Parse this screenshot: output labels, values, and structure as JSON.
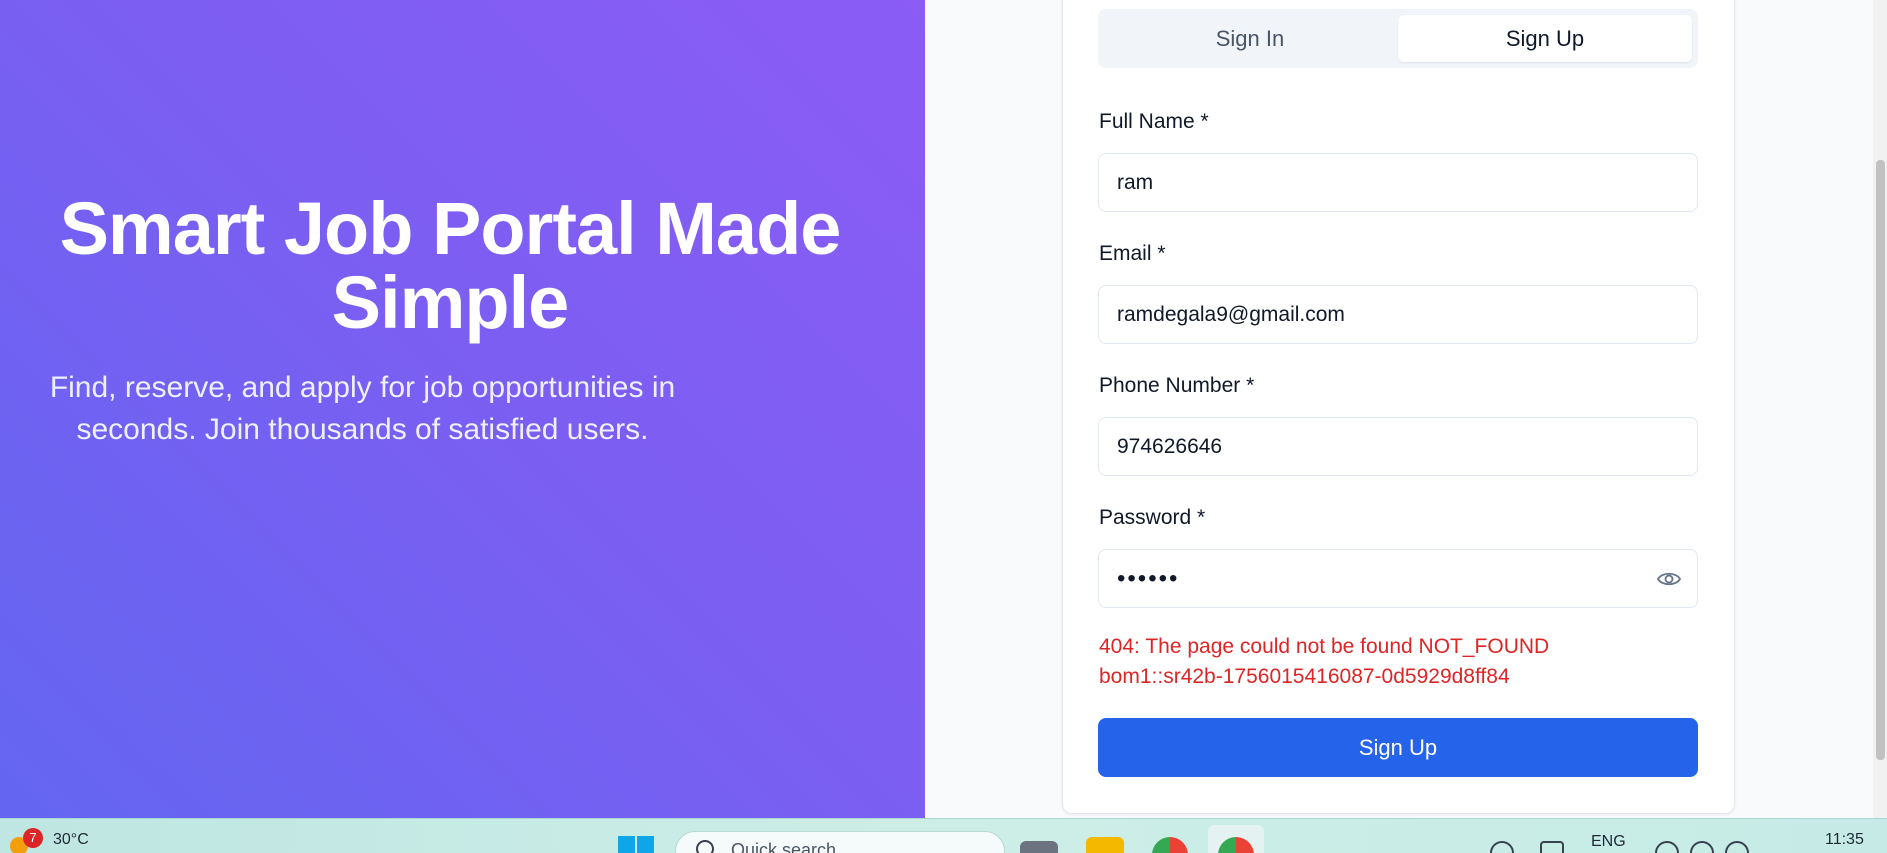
{
  "hero": {
    "title": "Smart Job Portal Made Simple",
    "subtitle": "Find, reserve, and apply for job opportunities in seconds. Join thousands of satisfied users."
  },
  "auth": {
    "tabs": {
      "signin": "Sign In",
      "signup": "Sign Up",
      "active": "Sign Up"
    },
    "fields": {
      "full_name": {
        "label": "Full Name *",
        "value": "ram"
      },
      "email": {
        "label": "Email *",
        "value": "ramdegala9@gmail.com"
      },
      "phone": {
        "label": "Phone Number *",
        "value": "974626646"
      },
      "password": {
        "label": "Password *",
        "value": "••••••"
      }
    },
    "error_line1": "404: The page could not be found NOT_FOUND",
    "error_line2": "bom1::sr42b-1756015416087-0d5929d8ff84",
    "submit_label": "Sign Up"
  },
  "taskbar": {
    "weather_badge": "7",
    "temperature": "30°C",
    "search_placeholder": "Quick search",
    "language": "ENG",
    "time": "11:35"
  },
  "colors": {
    "hero_gradient_start": "#6366f1",
    "hero_gradient_end": "#8b5cf6",
    "primary_button": "#2563eb",
    "error_text": "#dc2626"
  }
}
